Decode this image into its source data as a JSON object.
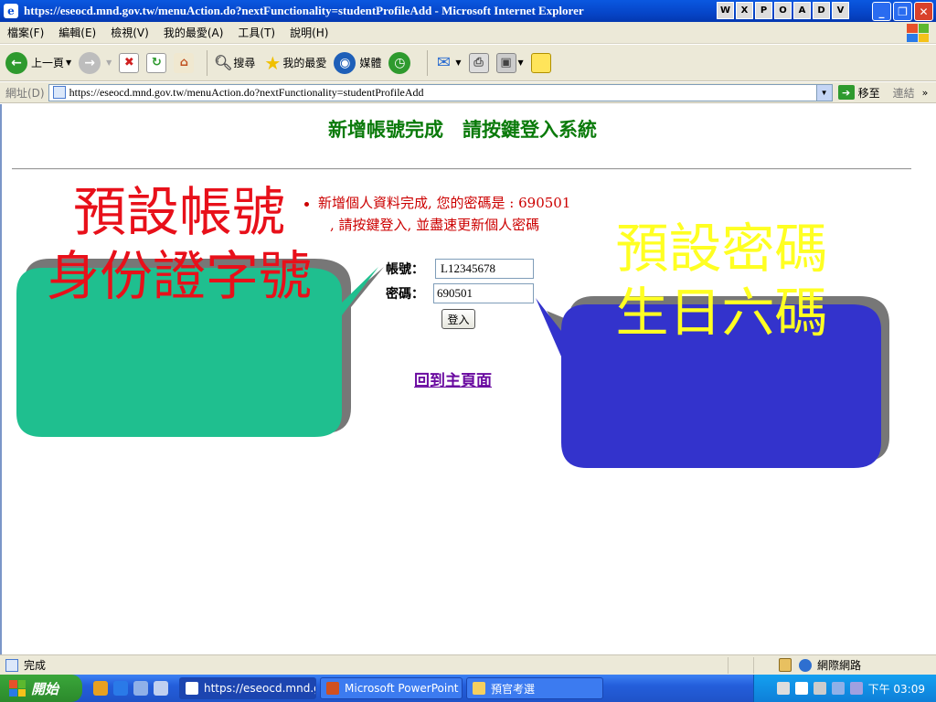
{
  "window": {
    "title": "https://eseocd.mnd.gov.tw/menuAction.do?nextFunctionality=studentProfileAdd - Microsoft Internet Explorer",
    "title_app_icons": [
      "W",
      "X",
      "P",
      "O",
      "A",
      "D",
      "V"
    ]
  },
  "menu": {
    "items": [
      "檔案(F)",
      "編輯(E)",
      "檢視(V)",
      "我的最愛(A)",
      "工具(T)",
      "說明(H)"
    ]
  },
  "toolbar": {
    "back_label": "上一頁",
    "search_label": "搜尋",
    "favorites_label": "我的最愛",
    "media_label": "媒體"
  },
  "address": {
    "label": "網址(D)",
    "url": "https://eseocd.mnd.gov.tw/menuAction.do?nextFunctionality=studentProfileAdd",
    "go_label": "移至",
    "links_label": "連結",
    "more": "»"
  },
  "page": {
    "heading": "新增帳號完成　請按鍵登入系統",
    "message_line1": "新增個人資料完成, 您的密碼是 : 690501",
    "message_line2": ", 請按鍵登入, 並盡速更新個人密碼",
    "account_label": "帳號：",
    "account_value": "L12345678",
    "password_label": "密碼：",
    "password_value": "690501",
    "login_button": "登入",
    "home_link": "回到主頁面"
  },
  "callouts": {
    "left_line1": "預設帳號",
    "left_line2": "身份證字號",
    "left_bg": "#1fbf8f",
    "left_text_color": "#e8101a",
    "right_line1": "預設密碼",
    "right_line2": "生日六碼",
    "right_bg": "#3333cc",
    "right_text_color": "#ffff22"
  },
  "status": {
    "text": "完成",
    "zone": "網際網路"
  },
  "taskbar": {
    "start_label": "開始",
    "tasks": [
      {
        "label": "https://eseocd.mnd.gov...",
        "icon": "ie-icon"
      },
      {
        "label": "Microsoft PowerPoint ...",
        "icon": "powerpoint-icon"
      },
      {
        "label": "預官考選",
        "icon": "folder-icon"
      }
    ],
    "clock": "下午 03:09"
  }
}
